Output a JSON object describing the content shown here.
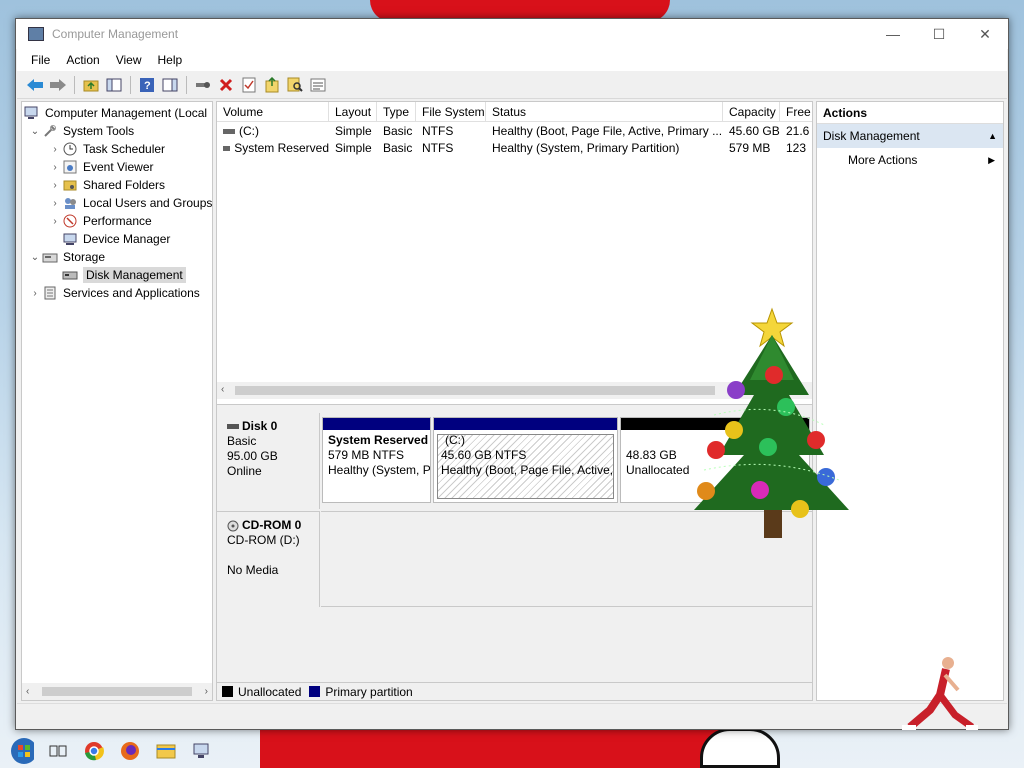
{
  "window": {
    "title": "Computer Management",
    "controls": {
      "minimize": "—",
      "maximize": "☐",
      "close": "✕"
    }
  },
  "menu": [
    "File",
    "Action",
    "View",
    "Help"
  ],
  "toolbar_icons": [
    "back-icon",
    "forward-icon",
    "up-folder-icon",
    "show-hide-tree-icon",
    "help-icon",
    "properties-panel-icon",
    "connect-icon",
    "delete-icon",
    "check-icon",
    "export-icon",
    "search-icon",
    "list-icon"
  ],
  "tree": {
    "root": "Computer Management (Local",
    "items": [
      {
        "label": "System Tools",
        "icon": "tools-icon"
      },
      {
        "label": "Task Scheduler",
        "icon": "clock-icon"
      },
      {
        "label": "Event Viewer",
        "icon": "event-icon"
      },
      {
        "label": "Shared Folders",
        "icon": "folder-icon"
      },
      {
        "label": "Local Users and Groups",
        "icon": "users-icon"
      },
      {
        "label": "Performance",
        "icon": "performance-icon"
      },
      {
        "label": "Device Manager",
        "icon": "device-icon"
      },
      {
        "label": "Storage",
        "icon": "storage-icon"
      },
      {
        "label": "Disk Management",
        "icon": "disk-icon"
      },
      {
        "label": "Services and Applications",
        "icon": "services-icon"
      }
    ]
  },
  "volumes": {
    "columns": [
      "Volume",
      "Layout",
      "Type",
      "File System",
      "Status",
      "Capacity",
      "Free"
    ],
    "rows": [
      {
        "volume": "(C:)",
        "layout": "Simple",
        "type": "Basic",
        "fs": "NTFS",
        "status": "Healthy (Boot, Page File, Active, Primary ...",
        "capacity": "45.60 GB",
        "free": "21.6"
      },
      {
        "volume": "System Reserved",
        "layout": "Simple",
        "type": "Basic",
        "fs": "NTFS",
        "status": "Healthy (System, Primary Partition)",
        "capacity": "579 MB",
        "free": "123"
      }
    ]
  },
  "disks": [
    {
      "name": "Disk 0",
      "type": "Basic",
      "size": "95.00 GB",
      "state": "Online",
      "partitions": [
        {
          "name": "System Reserved",
          "size": "579 MB NTFS",
          "status": "Healthy (System, P"
        },
        {
          "name": "(C:)",
          "size": "45.60 GB NTFS",
          "status": "Healthy (Boot, Page File, Active,"
        },
        {
          "name": "",
          "size": "48.83 GB",
          "status": "Unallocated"
        }
      ]
    },
    {
      "name": "CD-ROM 0",
      "type": "CD-ROM (D:)",
      "state": "No Media"
    }
  ],
  "legend": [
    {
      "label": "Unallocated",
      "color": "#000000"
    },
    {
      "label": "Primary partition",
      "color": "#00007f"
    }
  ],
  "actions": {
    "header": "Actions",
    "section": "Disk Management",
    "items": [
      "More Actions"
    ]
  },
  "colors": {
    "primary_partition": "#00007f",
    "unallocated": "#000000",
    "selection": "#dbe6f2"
  }
}
